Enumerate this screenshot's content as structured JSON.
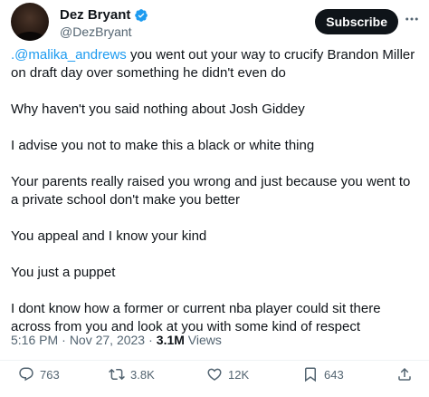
{
  "author": {
    "display_name": "Dez Bryant",
    "handle": "@DezBryant",
    "verified": true
  },
  "header": {
    "subscribe_label": "Subscribe"
  },
  "tweet": {
    "mention": ".@malika_andrews",
    "para1_rest": " you went out your way to crucify Brandon Miller on draft day over something he didn't even do",
    "para2": "Why haven't you said nothing about Josh Giddey",
    "para3": "I advise you not to make this a black or white thing",
    "para4": "Your parents really raised you wrong and just because you went to a private school don't make you better",
    "para5": "You appeal and I know your kind",
    "para6": "You just a puppet",
    "para7": "I dont know how a former or current nba player could sit there across from you and look at you with some kind of respect"
  },
  "meta": {
    "time": "5:16 PM",
    "separator": "·",
    "date": "Nov 27, 2023",
    "views_count": "3.1M",
    "views_label": "Views"
  },
  "actions": {
    "replies": "763",
    "reposts": "3.8K",
    "likes": "12K",
    "bookmarks": "643"
  },
  "colors": {
    "accent": "#1d9bf0",
    "text": "#0f1419",
    "secondary": "#536471"
  }
}
